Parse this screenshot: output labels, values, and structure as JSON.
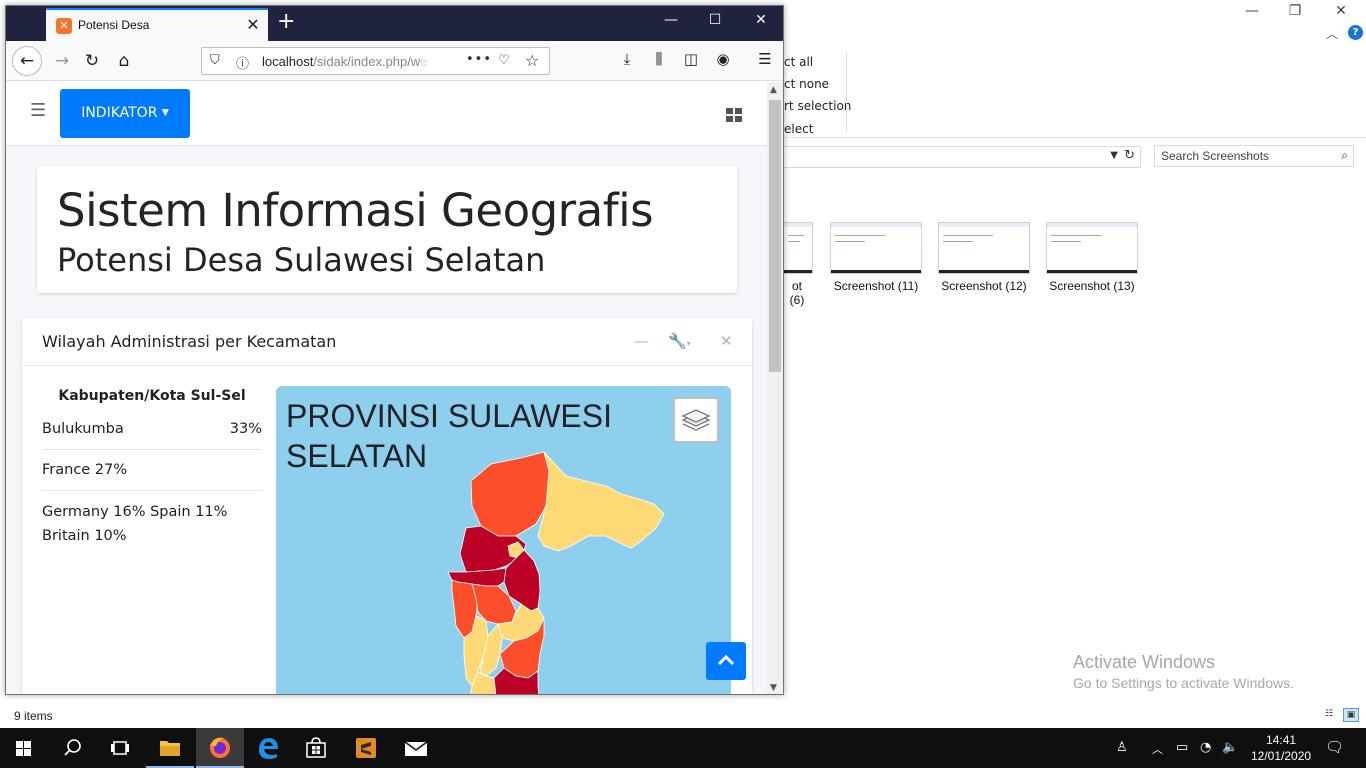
{
  "explorer": {
    "window_controls": [
      "—",
      "❐",
      "✕"
    ],
    "ribbon_items": [
      "ct all",
      "ct none",
      "rt selection",
      "elect"
    ],
    "search_placeholder": "Search Screenshots",
    "thumbnails": [
      "ot (6)",
      "Screenshot (11)",
      "Screenshot (12)",
      "Screenshot (13)"
    ],
    "status": "9 items",
    "activation": {
      "title": "Activate Windows",
      "subtitle": "Go to Settings to activate Windows."
    }
  },
  "firefox": {
    "tab_title": "Potensi Desa",
    "url_host": "localhost",
    "url_path": "/sidak/index.php/w",
    "url_overflow": "e",
    "page_actions": "•••"
  },
  "page": {
    "indikator_label": "INDIKATOR",
    "header_title": "Sistem Informasi Geografis",
    "header_subtitle": "Potensi Desa Sulawesi Selatan",
    "card": {
      "title": "Wilayah Administrasi per Kecamatan",
      "stats_title": "Kabupaten/Kota Sul-Sel",
      "stats": [
        {
          "name": "Bulukumba",
          "value": "33%"
        },
        {
          "text": "France 27%"
        },
        {
          "text": "Germany 16% Spain 11% Britain 10%"
        }
      ],
      "map_title": "PROVINSI SULAWESI SELATAN",
      "map_colors": {
        "water": "#8ecfee",
        "high": "#bd0026",
        "mid": "#fc4e2a",
        "low": "#fed976"
      }
    }
  },
  "taskbar": {
    "time": "14:41",
    "date": "12/01/2020"
  }
}
